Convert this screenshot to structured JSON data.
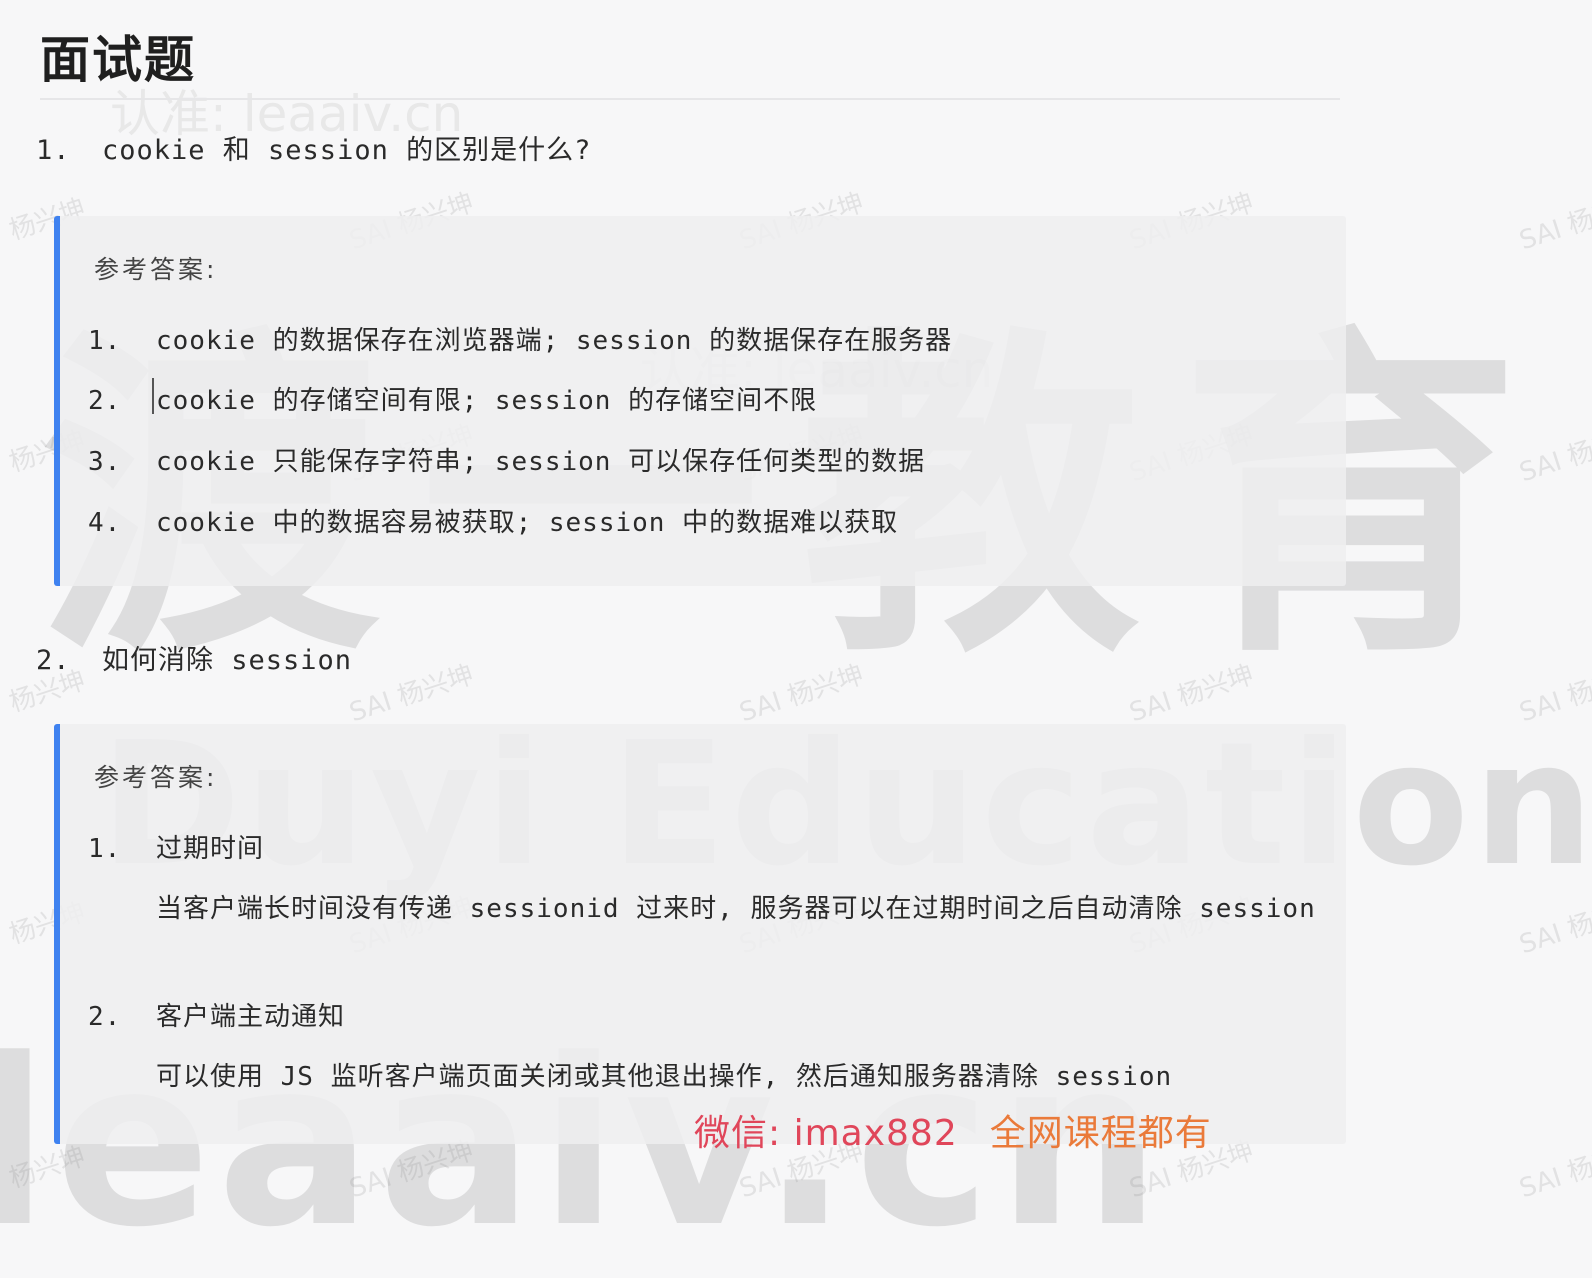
{
  "title": "面试题",
  "questions": [
    {
      "number": "1.",
      "text": "cookie 和 session 的区别是什么?",
      "answer_label": "参考答案:",
      "answers": [
        {
          "number": "1.",
          "text": "cookie 的数据保存在浏览器端; session 的数据保存在服务器"
        },
        {
          "number": "2.",
          "text": "cookie 的存储空间有限; session 的存储空间不限"
        },
        {
          "number": "3.",
          "text": "cookie 只能保存字符串; session 可以保存任何类型的数据"
        },
        {
          "number": "4.",
          "text": "cookie 中的数据容易被获取; session 中的数据难以获取"
        }
      ]
    },
    {
      "number": "2.",
      "text": "如何消除 session",
      "answer_label": "参考答案:",
      "answers": [
        {
          "number": "1.",
          "text": "过期时间",
          "detail": "当客户端长时间没有传递 sessionid 过来时, 服务器可以在过期时间之后自动清除 session"
        },
        {
          "number": "2.",
          "text": "客户端主动通知",
          "detail": "可以使用 JS 监听客户端页面关闭或其他退出操作, 然后通知服务器清除 session"
        }
      ]
    }
  ],
  "watermarks": {
    "brand_cn": "渡一教育",
    "brand_en": "Duyi Education",
    "site": "leaaiv.cn",
    "site_label": "认准: leaaiv.cn",
    "tile": "SAI 杨兴坤",
    "tile_short": "杨兴坤"
  },
  "promo": {
    "wechat": "微信: imax882",
    "slogan": "全网课程都有"
  },
  "colors": {
    "accent": "#3f82f0",
    "promo_red": "#e0465a",
    "promo_orange": "#ea7a3a"
  }
}
